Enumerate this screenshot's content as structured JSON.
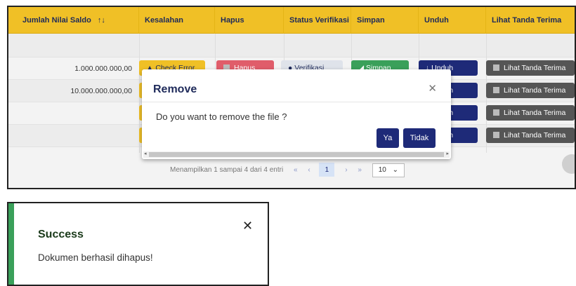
{
  "table": {
    "headers": [
      "Jumlah Nilai Saldo",
      "Kesalahan",
      "Hapus",
      "Status Verifikasi",
      "Simpan",
      "Unduh",
      "Lihat Tanda Terima"
    ],
    "sort_icon": "sort-icon",
    "rows": [
      {
        "saldo": "",
        "has_buttons": false
      },
      {
        "saldo": "1.000.000.000,00"
      },
      {
        "saldo": "10.000.000.000,00"
      },
      {
        "saldo": ""
      },
      {
        "saldo": ""
      }
    ],
    "buttons": {
      "check_error": "Check Error",
      "hapus": "Hapus",
      "verifikasi": "Verifikasi",
      "simpan": "Simpan",
      "unduh": "Unduh",
      "lihat": "Lihat Tanda Terima"
    },
    "pagination": {
      "info": "Menampilkan 1 sampai 4 dari 4 entri",
      "first": "«",
      "prev": "‹",
      "current": "1",
      "next": "›",
      "last": "»",
      "page_size": "10"
    }
  },
  "modal": {
    "title": "Remove",
    "message": "Do you want to remove the file ?",
    "yes_label": "Ya",
    "no_label": "Tidak"
  },
  "toast": {
    "title": "Success",
    "message": "Dokumen berhasil dihapus!"
  },
  "colors": {
    "header_yellow": "#f0c026",
    "navy": "#1e2a78",
    "success_green": "#3aa05a"
  }
}
